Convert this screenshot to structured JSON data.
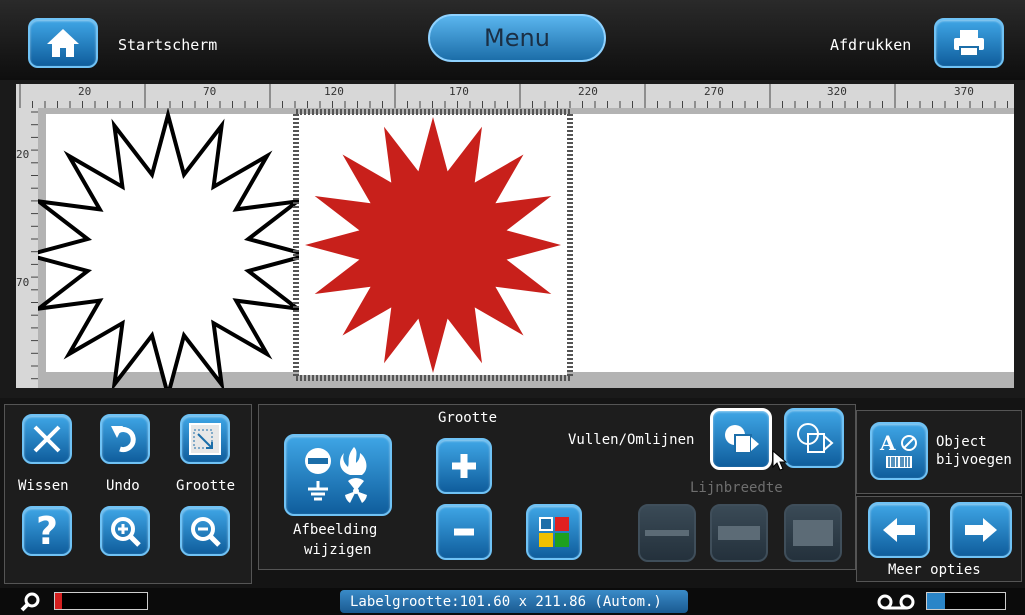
{
  "topbar": {
    "home_label": "Startscherm",
    "menu_label": "Menu",
    "print_label": "Afdrukken"
  },
  "ruler": {
    "h_ticks": [
      "20",
      "70",
      "120",
      "170",
      "220",
      "270",
      "320",
      "370"
    ],
    "v_ticks": [
      "20",
      "70"
    ]
  },
  "toolbar": {
    "wissen": "Wissen",
    "undo": "Undo",
    "grootte_btn": "Grootte",
    "afbeelding_line1": "Afbeelding",
    "afbeelding_line2": "wijzigen",
    "grootte_title": "Grootte",
    "vullen_label": "Vullen/Omlijnen",
    "lijnbreedte_label": "Lijnbreedte",
    "object_line1": "Object",
    "object_line2": "bijvoegen",
    "meer_opties": "Meer opties"
  },
  "status": {
    "label_size": "Labelgrootte:101.60 x 211.86 (Autom.)"
  },
  "colors": {
    "accent_blue": "#1c74b8",
    "star_fill": "#c8201b"
  },
  "icons": [
    "home-icon",
    "printer-icon",
    "close-icon",
    "undo-icon",
    "resize-icon",
    "help-icon",
    "zoom-in-icon",
    "zoom-out-icon",
    "hazard-symbols-icon",
    "plus-icon",
    "minus-icon",
    "grid-color-icon",
    "fill-icon",
    "outline-icon",
    "text-barcode-icon",
    "arrow-left-icon",
    "arrow-right-icon",
    "search-icon",
    "tape-icon"
  ]
}
